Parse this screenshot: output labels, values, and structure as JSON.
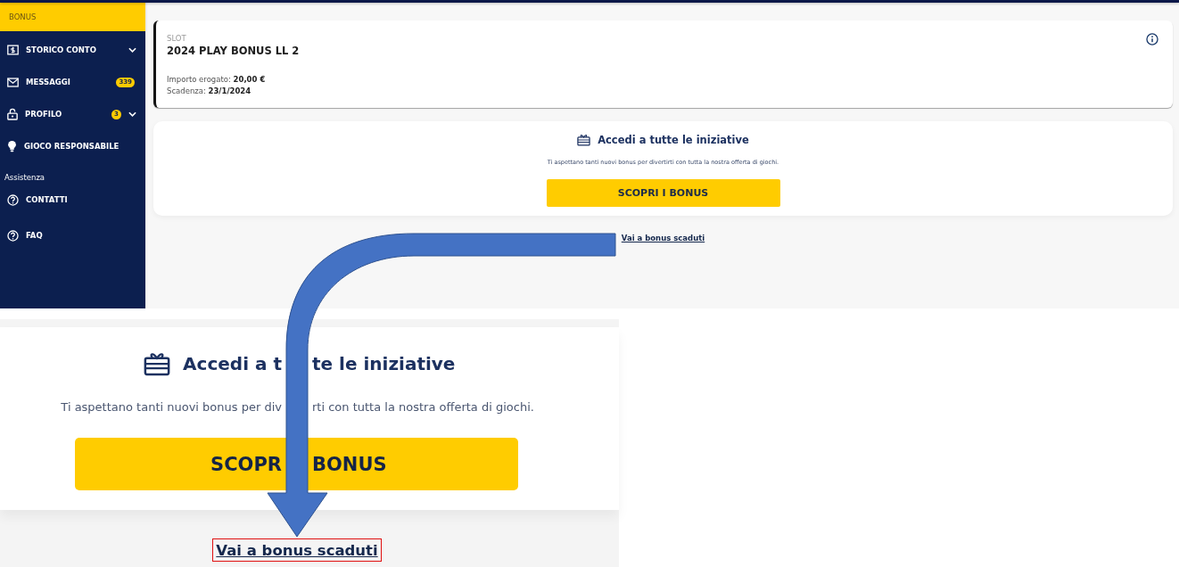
{
  "sidebar": {
    "items": [
      {
        "label": "BONUS",
        "kind": "link",
        "selected": true
      },
      {
        "label": "STORICO CONTO",
        "kind": "menu",
        "selected": false
      },
      {
        "label": "MESSAGGI",
        "kind": "link",
        "badge": "339",
        "selected": false
      },
      {
        "label": "PROFILO",
        "kind": "menu",
        "badge": "3",
        "selected": false
      },
      {
        "label": "GIOCO RESPONSABILE",
        "kind": "link",
        "selected": false
      }
    ],
    "section_title": "Assistenza",
    "support_items": [
      {
        "label": "CONTATTI",
        "selected": false
      },
      {
        "label": "FAQ",
        "selected": false
      }
    ]
  },
  "bonus_card": {
    "category": "SLOT",
    "title": "2024 PLAY BONUS LL 2",
    "details": [
      "Importo erogato: **20,00 €**",
      "Scadenza: **23/1/2024**"
    ]
  },
  "promo_card": {
    "title": "Accedi a tutte le iniziative",
    "text": "Ti aspettano tanti nuovi bonus per divertirti con tutta la nostra offerta di giochi.",
    "button": "SCOPRI I BONUS"
  },
  "expired_link": "Vai a bonus scaduti",
  "zoom_inset": {
    "title_parts": [
      "Accedi a t",
      "te le iniziative"
    ],
    "text_parts": [
      "Ti aspettano tanti nuovi bonus per div",
      "rti con tutta la nostra offerta di giochi."
    ],
    "button_parts": [
      "SCOPR",
      "BONUS"
    ],
    "link": "Vai a bonus scaduti",
    "highlighted": true
  }
}
